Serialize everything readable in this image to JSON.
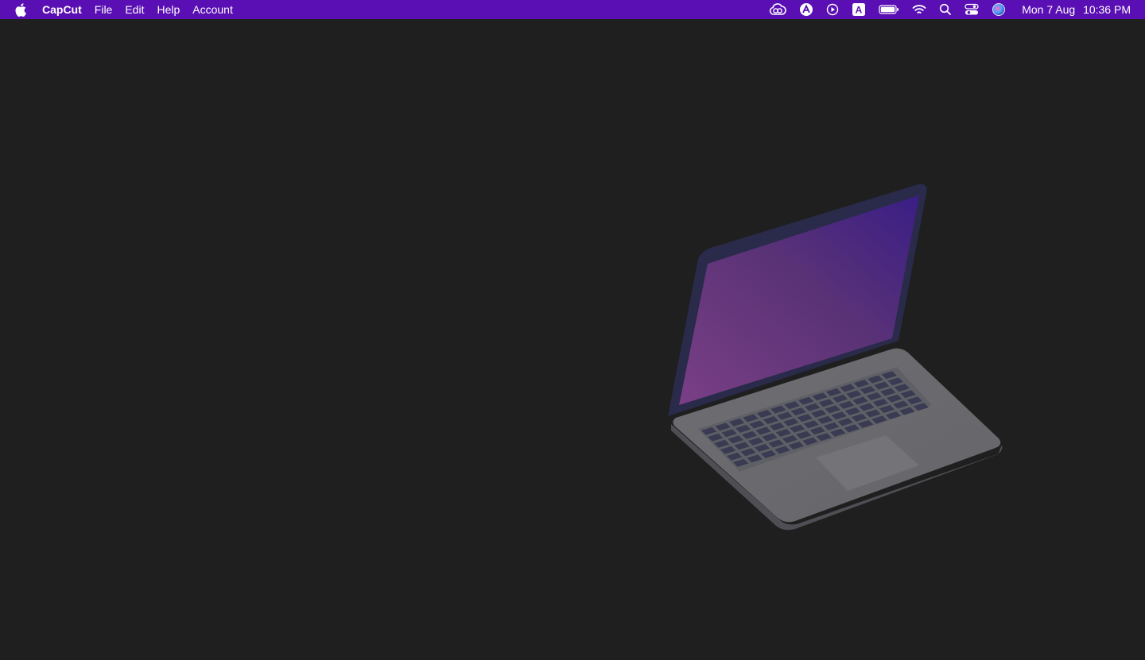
{
  "menubar": {
    "background": "#5a0fb4",
    "apple_icon": "apple-logo-icon",
    "app_name": "CapCut",
    "menus": [
      "File",
      "Edit",
      "Help",
      "Account"
    ],
    "status_icons": [
      "creative-cloud-icon",
      "autodesk-icon",
      "play-circle-icon",
      "input-source-icon",
      "battery-icon",
      "wifi-icon",
      "spotlight-search-icon",
      "control-center-icon",
      "siri-icon"
    ],
    "input_source_letter": "A",
    "clock": {
      "date": "Mon 7 Aug",
      "time": "10:36 PM"
    }
  },
  "desktop": {
    "background": "#1f1f1f",
    "illustration": "laptop-illustration-icon"
  }
}
